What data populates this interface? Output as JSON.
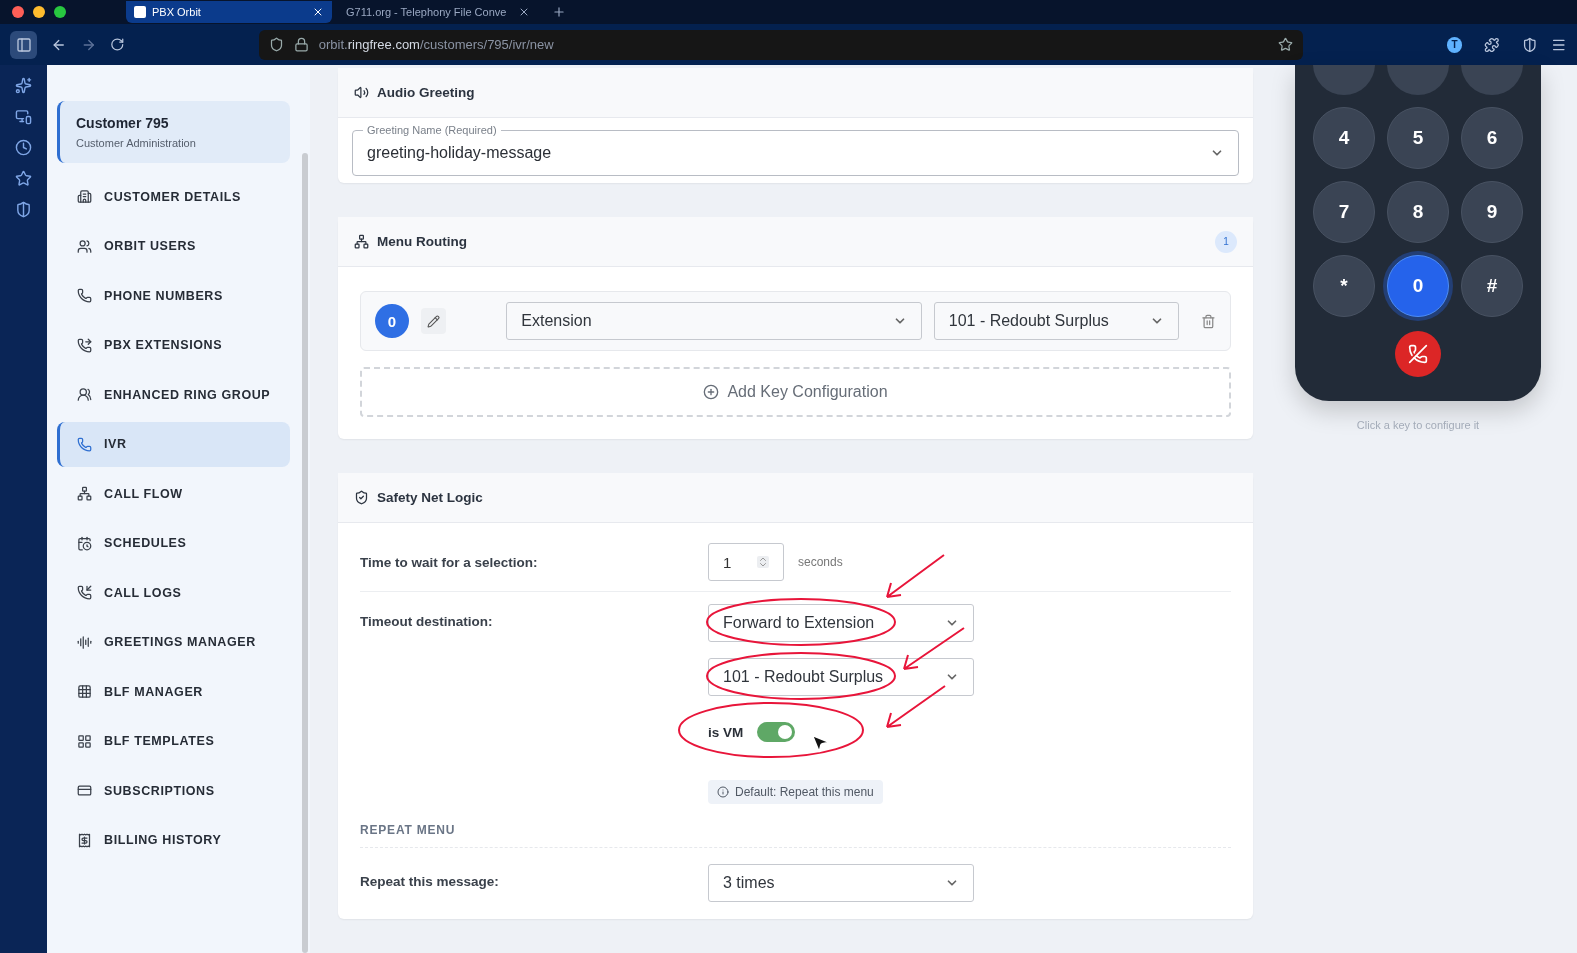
{
  "browser": {
    "tabs": [
      {
        "title": "PBX Orbit",
        "selected": true
      },
      {
        "title": "G711.org - Telephony File Conve",
        "selected": false
      }
    ],
    "url": {
      "prefix": "orbit.",
      "domain": "ringfree.com",
      "path": "/customers/795/ivr/new"
    },
    "profile": "T"
  },
  "sidebar": {
    "customer": {
      "name": "Customer 795",
      "subtitle": "Customer Administration"
    },
    "items": [
      {
        "label": "CUSTOMER DETAILS",
        "selected": false
      },
      {
        "label": "ORBIT USERS",
        "selected": false
      },
      {
        "label": "PHONE NUMBERS",
        "selected": false
      },
      {
        "label": "PBX EXTENSIONS",
        "selected": false
      },
      {
        "label": "ENHANCED RING GROUP",
        "selected": false
      },
      {
        "label": "IVR",
        "selected": true
      },
      {
        "label": "CALL FLOW",
        "selected": false
      },
      {
        "label": "SCHEDULES",
        "selected": false
      },
      {
        "label": "CALL LOGS",
        "selected": false
      },
      {
        "label": "GREETINGS MANAGER",
        "selected": false
      },
      {
        "label": "BLF MANAGER",
        "selected": false
      },
      {
        "label": "BLF TEMPLATES",
        "selected": false
      },
      {
        "label": "SUBSCRIPTIONS",
        "selected": false
      },
      {
        "label": "BILLING HISTORY",
        "selected": false
      }
    ]
  },
  "audio_greeting": {
    "title": "Audio Greeting",
    "field": {
      "label": "Greeting Name (Required)",
      "value": "greeting-holiday-message"
    }
  },
  "menu_routing": {
    "title": "Menu Routing",
    "count": "1",
    "routes": [
      {
        "key": "0",
        "action": "Extension",
        "target": "101 - Redoubt Surplus"
      }
    ],
    "add_button": "Add Key Configuration"
  },
  "safety_net": {
    "title": "Safety Net Logic",
    "wait": {
      "label": "Time to wait for a selection:",
      "value": "1",
      "unit": "seconds"
    },
    "timeout": {
      "label": "Timeout destination:",
      "destination": "Forward to Extension",
      "target": "101 - Redoubt Surplus",
      "vm": {
        "label": "is VM",
        "on": true
      },
      "hint": "Default: Repeat this menu"
    },
    "repeat_heading": "REPEAT MENU",
    "repeat": {
      "label": "Repeat this message:",
      "value": "3 times"
    }
  },
  "keypad": {
    "keys": [
      {
        "label": "4",
        "selected": false
      },
      {
        "label": "5",
        "selected": false
      },
      {
        "label": "6",
        "selected": false
      },
      {
        "label": "7",
        "selected": false
      },
      {
        "label": "8",
        "selected": false
      },
      {
        "label": "9",
        "selected": false
      },
      {
        "label": "*",
        "selected": false
      },
      {
        "label": "0",
        "selected": true
      },
      {
        "label": "#",
        "selected": false
      }
    ],
    "hint": "Click a key to configure it"
  }
}
